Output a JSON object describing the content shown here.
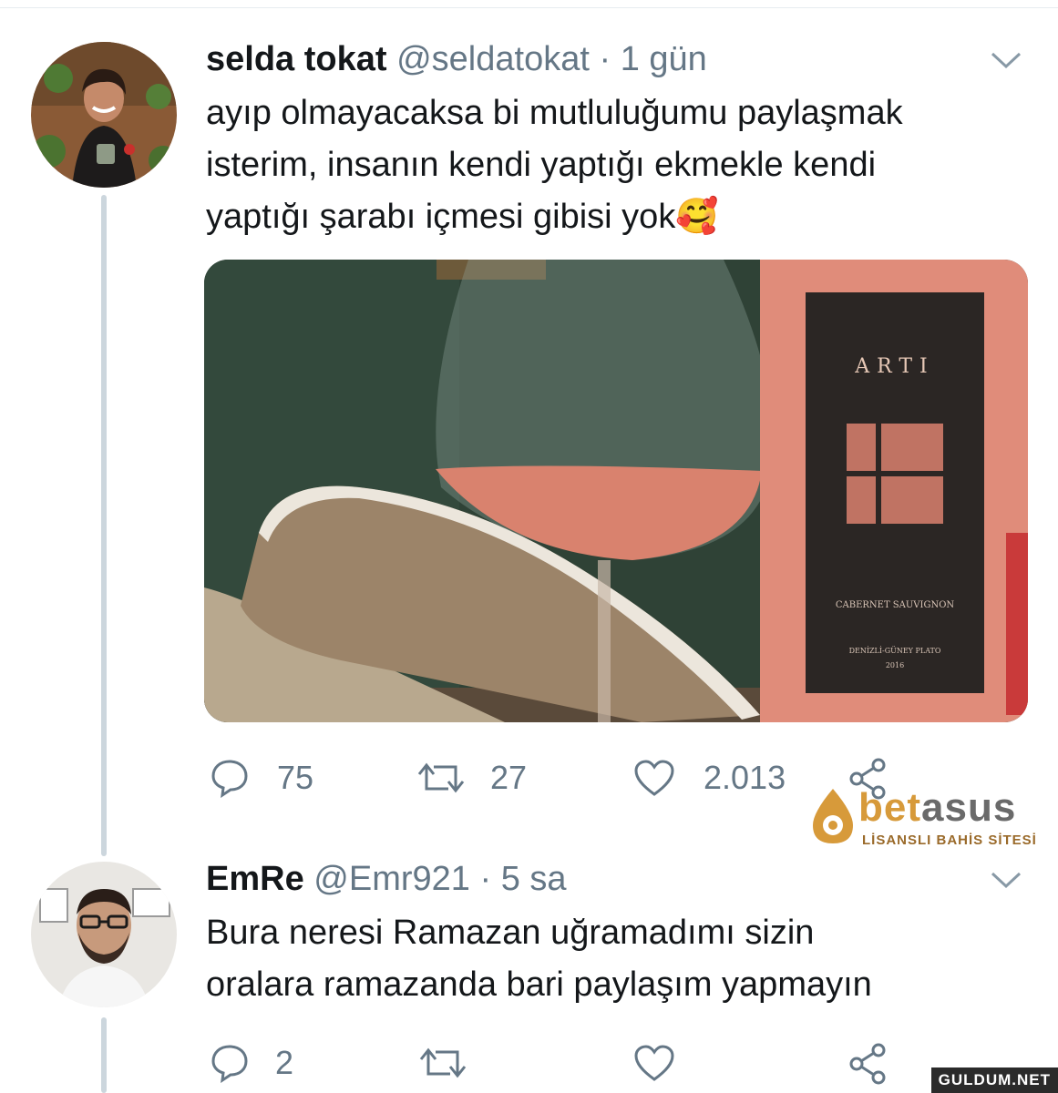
{
  "tweets": [
    {
      "name": "selda tokat",
      "handle": "@seldatokat",
      "separator": "·",
      "time": "1 gün",
      "text": "ayıp olmayacaksa bi mutluluğumu paylaşmak\nisterim, insanın kendi yaptığı ekmekle kendi\nyaptığı şarabı içmesi gibisi yok",
      "emoji": "🥰",
      "replies": "75",
      "retweets": "27",
      "likes": "2.013"
    },
    {
      "name": "EmRe",
      "handle": "@Emr921",
      "separator": "·",
      "time": "5 sa",
      "text": "Bura neresi Ramazan uğramadımı sizin\noralara ramazanda bari paylaşım yapmayın",
      "replies": "2"
    }
  ],
  "media": {
    "label_brand": "ARTI",
    "label_variety": "CABERNET SAUVIGNON",
    "label_region": "DENİZLİ-GÜNEY PLATO",
    "label_year": "2016"
  },
  "watermark": {
    "brand_a": "bet",
    "brand_b": "asus",
    "tagline": "LİSANSLI BAHİS SİTESİ"
  },
  "corner_mark": "GULDUM.NET",
  "colors": {
    "meta_gray": "#657786",
    "thread_line": "#ccd6dd",
    "wine_rose": "#d9826e"
  },
  "icons": {
    "reply": "speech-bubble-icon",
    "retweet": "retweet-arrows-icon",
    "like": "heart-outline-icon",
    "share": "share-nodes-icon",
    "more": "chevron-down-icon"
  }
}
